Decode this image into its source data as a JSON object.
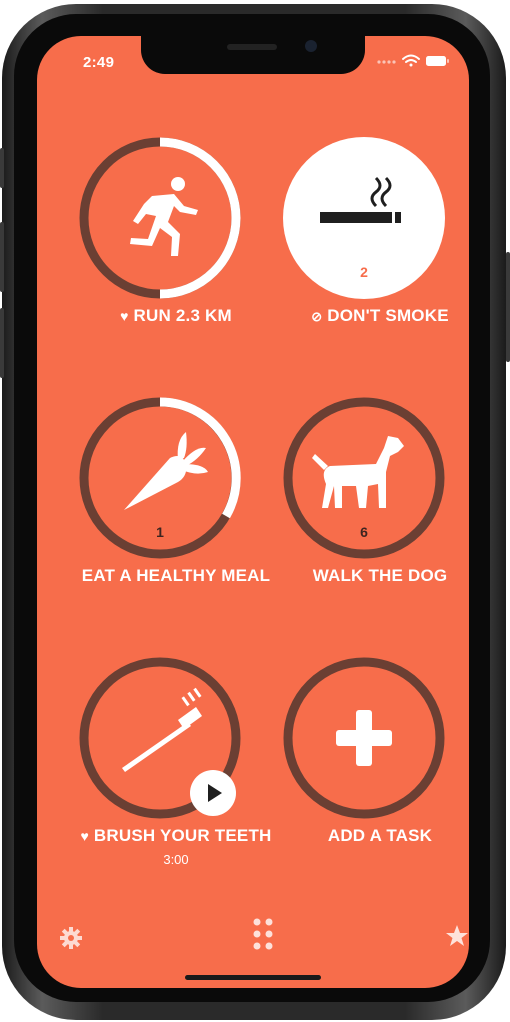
{
  "status_bar": {
    "time": "2:49"
  },
  "tasks": [
    {
      "label": "RUN 2.3 KM",
      "prefix_icon": "heart-icon",
      "icon": "runner-icon",
      "count": "",
      "progress": 0.5
    },
    {
      "label": "DON'T SMOKE",
      "prefix_icon": "no-entry-icon",
      "icon": "cigarette-icon",
      "count": "2",
      "progress": 1.0,
      "completed": true
    },
    {
      "label": "EAT A HEALTHY MEAL",
      "prefix_icon": "",
      "icon": "carrot-icon",
      "count": "1",
      "progress": 0.35
    },
    {
      "label": "WALK THE DOG",
      "prefix_icon": "",
      "icon": "dog-icon",
      "count": "6",
      "progress": 0
    },
    {
      "label": "BRUSH YOUR TEETH",
      "prefix_icon": "heart-icon",
      "icon": "toothbrush-icon",
      "count": "",
      "duration": "3:00",
      "progress": 0,
      "action_icon": "play-icon"
    },
    {
      "label": "ADD A TASK",
      "prefix_icon": "",
      "icon": "plus-icon",
      "count": "",
      "progress": 0
    }
  ],
  "bottom_bar": {
    "left_icon": "gear-icon",
    "center_icon": "grid-dots-icon",
    "right_icon": "star-icon"
  },
  "colors": {
    "background": "#f76d4b",
    "ring_track": "#6b3f33",
    "ring_progress": "#ffffff"
  }
}
